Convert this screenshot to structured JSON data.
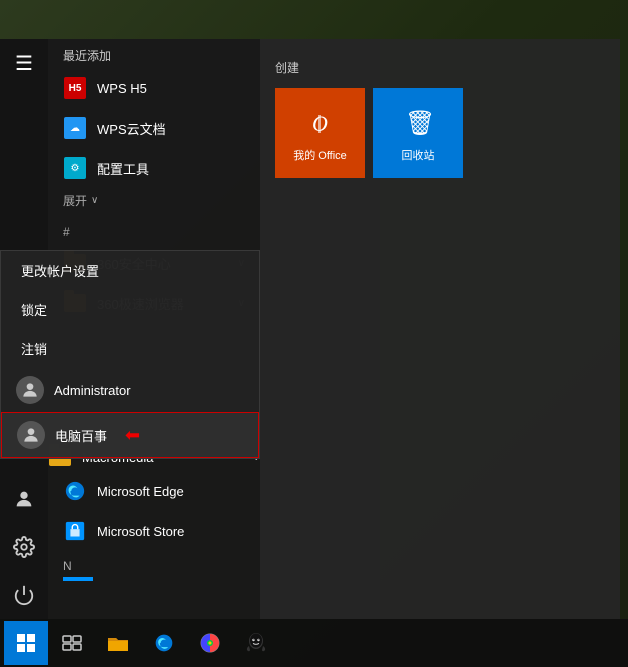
{
  "desktop": {
    "background": "#2d3a1e"
  },
  "taskbar": {
    "start_label": "⊞",
    "apps": [
      "task-view",
      "file-explorer",
      "browser",
      "color-picker",
      "qq"
    ]
  },
  "start_menu": {
    "hamburger": "☰",
    "section_recent": "最近添加",
    "section_create": "创建",
    "expand": "展开",
    "alpha_hash": "#",
    "items_recent": [
      {
        "label": "WPS H5",
        "icon": "wps"
      },
      {
        "label": "WPS云文档",
        "icon": "cloud"
      },
      {
        "label": "配置工具",
        "icon": "config"
      }
    ],
    "items_alpha": [
      {
        "label": "360安全中心",
        "icon": "folder360"
      },
      {
        "label": "360极速浏览器",
        "icon": "folder360"
      }
    ],
    "items_m": [
      {
        "label": "Macromedia",
        "icon": "folderM"
      },
      {
        "label": "Microsoft Edge",
        "icon": "edge"
      },
      {
        "label": "Microsoft Store",
        "icon": "store"
      }
    ],
    "alpha_n": "N",
    "tiles": [
      {
        "id": "office",
        "label": "我的 Office",
        "bg": "#d04000"
      },
      {
        "id": "recycle",
        "label": "回收站",
        "bg": "#0078d7"
      }
    ]
  },
  "context_menu": {
    "items": [
      {
        "label": "更改帐户设置"
      },
      {
        "label": "锁定"
      },
      {
        "label": "注销"
      }
    ],
    "users": [
      {
        "label": "Administrator",
        "selected": false
      },
      {
        "label": "电脑百事",
        "selected": true,
        "arrow": "⬅"
      }
    ]
  },
  "sidebar": {
    "icons": [
      "user",
      "settings",
      "power"
    ]
  }
}
